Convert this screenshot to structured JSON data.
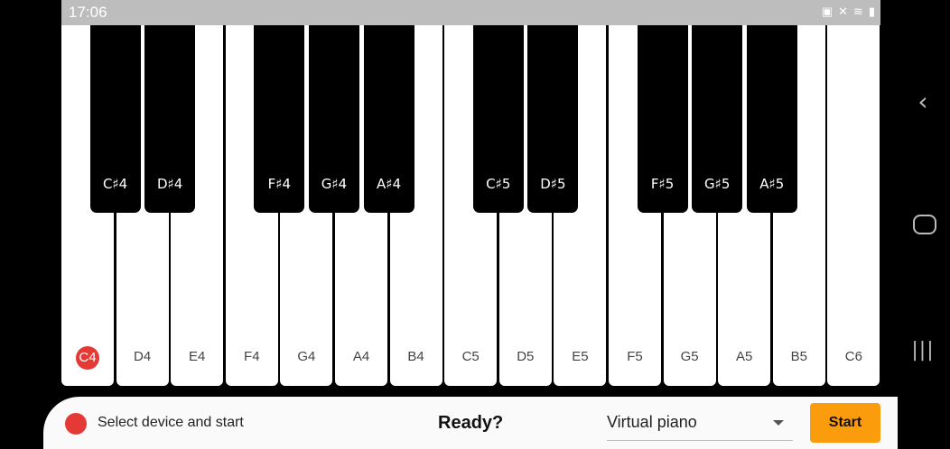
{
  "status": {
    "time": "17:06"
  },
  "piano": {
    "white_keys": [
      "C4",
      "D4",
      "E4",
      "F4",
      "G4",
      "A4",
      "B4",
      "C5",
      "D5",
      "E5",
      "F5",
      "G5",
      "A5",
      "B5",
      "C6"
    ],
    "black_keys": [
      "C♯4",
      "D♯4",
      "F♯4",
      "G♯4",
      "A♯4",
      "C♯5",
      "D♯5",
      "F♯5",
      "G♯5",
      "A♯5"
    ],
    "active_key": "C4"
  },
  "bottom_bar": {
    "device_status": "Select device and start",
    "ready_text": "Ready?",
    "input_select": "Virtual piano",
    "start_label": "Start"
  },
  "colors": {
    "accent": "#fb9c0c",
    "record": "#e53935",
    "status_bar": "#bdbdbd"
  },
  "icons": [
    "sim-icon",
    "mute-icon",
    "wifi-icon",
    "signal-icon",
    "battery-icon",
    "back-icon",
    "home-icon",
    "recents-icon"
  ]
}
